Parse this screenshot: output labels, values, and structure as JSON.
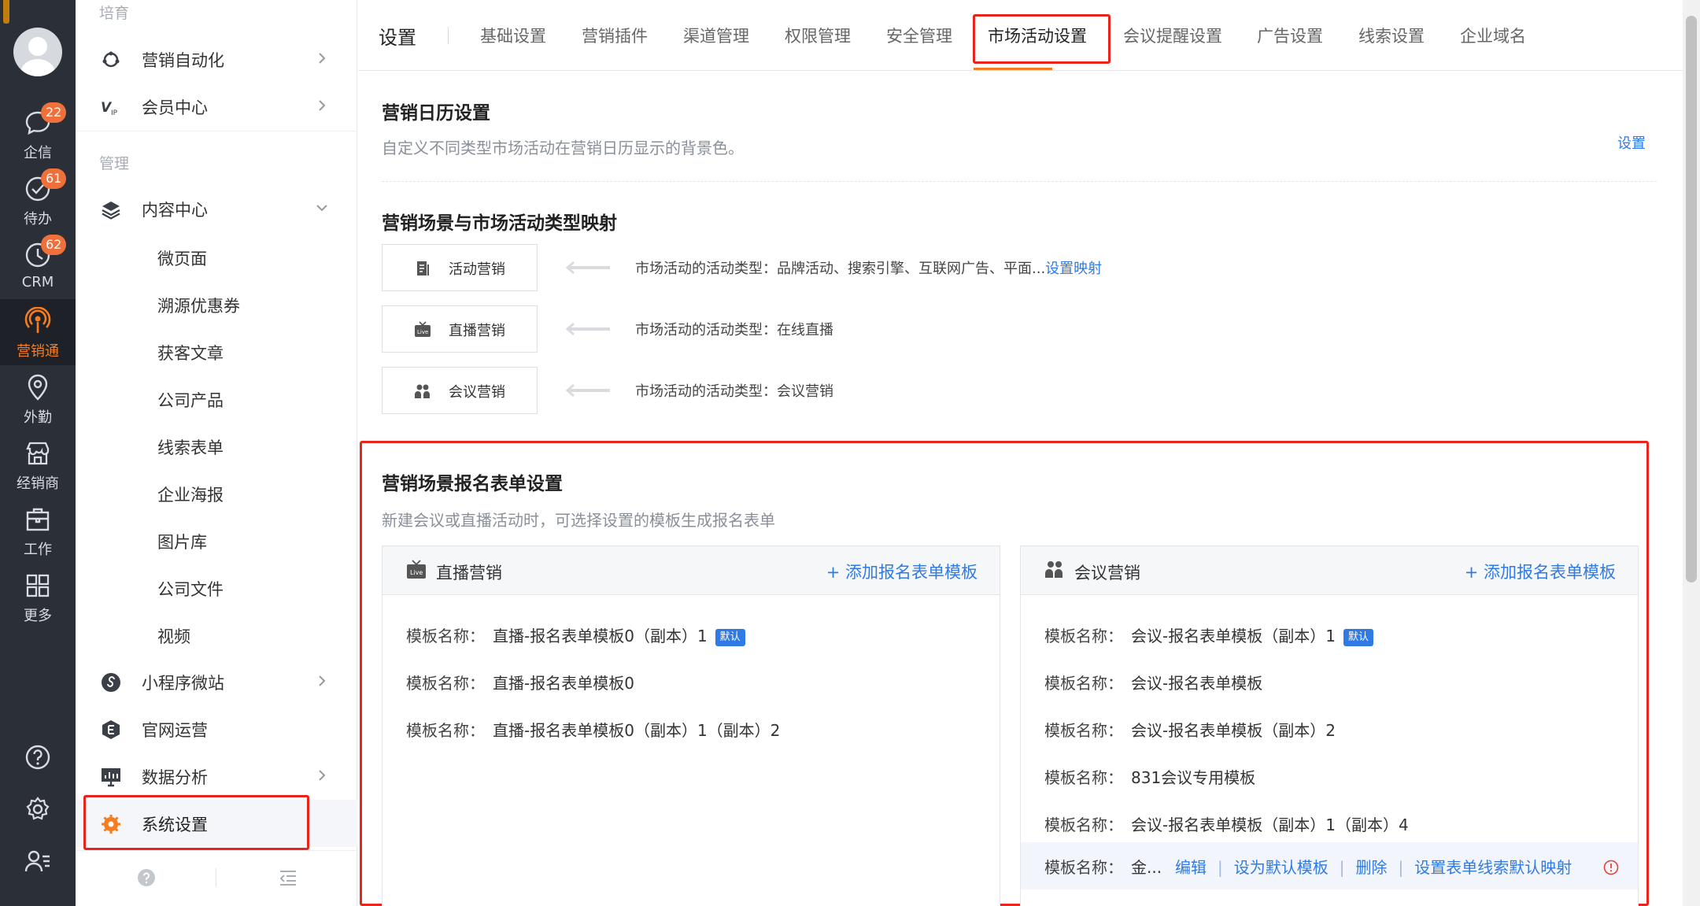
{
  "rail": {
    "items": [
      {
        "label": "企信",
        "icon": "chat-bubble-icon",
        "badge": "22"
      },
      {
        "label": "待办",
        "icon": "check-circle-icon",
        "badge": "61"
      },
      {
        "label": "CRM",
        "icon": "clock-icon",
        "badge": "62"
      },
      {
        "label": "营销通",
        "icon": "broadcast-icon",
        "active": true
      },
      {
        "label": "外勤",
        "icon": "location-pin-icon"
      },
      {
        "label": "经销商",
        "icon": "store-icon"
      },
      {
        "label": "工作",
        "icon": "briefcase-icon"
      },
      {
        "label": "更多",
        "icon": "grid-icon"
      }
    ],
    "bottom_icons": [
      "help-icon",
      "gear-icon",
      "user-list-icon"
    ],
    "accent": "#f57c1f"
  },
  "sidebar": {
    "section_cultivate": "培育",
    "section_manage": "管理",
    "items": {
      "automation": "营销自动化",
      "member": "会员中心",
      "content": "内容中心",
      "miniprogram": "小程序微站",
      "website": "官网运营",
      "analytics": "数据分析",
      "settings": "系统设置"
    },
    "content_children": [
      "微页面",
      "溯源优惠券",
      "获客文章",
      "公司产品",
      "线索表单",
      "企业海报",
      "图片库",
      "公司文件",
      "视频"
    ]
  },
  "tabs": {
    "title": "设置",
    "items": [
      "基础设置",
      "营销插件",
      "渠道管理",
      "权限管理",
      "安全管理",
      "市场活动设置",
      "会议提醒设置",
      "广告设置",
      "线索设置",
      "企业域名"
    ],
    "active": "市场活动设置"
  },
  "calendar": {
    "title": "营销日历设置",
    "desc": "自定义不同类型市场活动在营销日历显示的背景色。",
    "action": "设置"
  },
  "mapping": {
    "title": "营销场景与市场活动类型映射",
    "rows": [
      {
        "scene": "活动营销",
        "text": "市场活动的活动类型：品牌活动、搜索引擎、互联网广告、平面...",
        "link": "设置映射"
      },
      {
        "scene": "直播营销",
        "text": "市场活动的活动类型：在线直播"
      },
      {
        "scene": "会议营销",
        "text": "市场活动的活动类型：会议营销"
      }
    ]
  },
  "forms": {
    "title": "营销场景报名表单设置",
    "desc": "新建会议或直播活动时，可选择设置的模板生成报名表单",
    "key_label": "模板名称：",
    "default_badge": "默认",
    "live": {
      "title": "直播营销",
      "add": "+ 添加报名表单模板",
      "templates": [
        "直播-报名表单模板0（副本）1",
        "直播-报名表单模板0",
        "直播-报名表单模板0（副本）1（副本）2"
      ]
    },
    "meeting": {
      "title": "会议营销",
      "add": "+ 添加报名表单模板",
      "templates": [
        "会议-报名表单模板（副本）1",
        "会议-报名表单模板",
        "会议-报名表单模板（副本）2",
        "831会议专用模板",
        "会议-报名表单模板（副本）1（副本）4"
      ],
      "hover_row": {
        "value": "金...",
        "actions": [
          "编辑",
          "设为默认模板",
          "删除",
          "设置表单线索默认映射"
        ]
      }
    }
  }
}
